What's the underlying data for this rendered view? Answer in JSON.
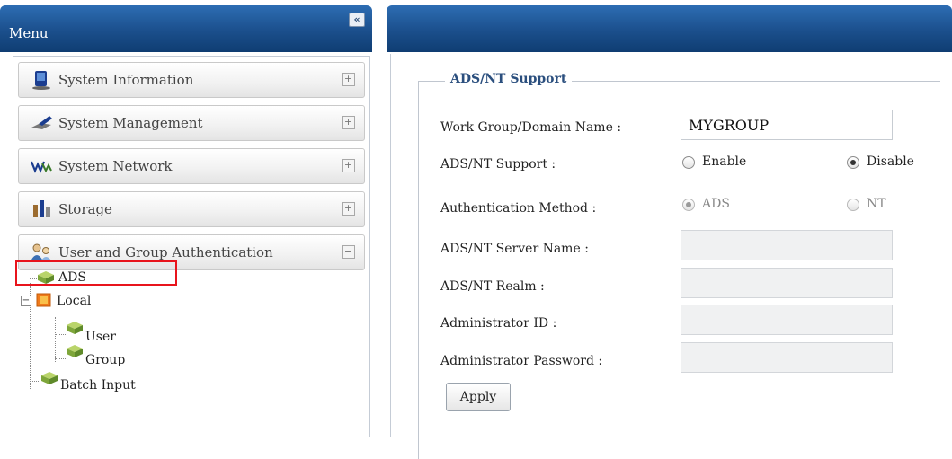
{
  "menu": {
    "title": "Menu",
    "collapse_glyph": "«",
    "items": [
      {
        "label": "System Information",
        "icon": "computer-icon",
        "expander": "+"
      },
      {
        "label": "System Management",
        "icon": "tools-icon",
        "expander": "+"
      },
      {
        "label": "System Network",
        "icon": "network-icon",
        "expander": "+"
      },
      {
        "label": "Storage",
        "icon": "storage-icon",
        "expander": "+"
      },
      {
        "label": "User and Group Authentication",
        "icon": "users-icon",
        "expander": "−"
      }
    ],
    "tree": {
      "ads": "ADS",
      "local": "Local",
      "local_expander": "−",
      "user": "User",
      "group": "Group",
      "batch": "Batch Input"
    }
  },
  "form": {
    "section_title": "ADS/NT Support",
    "workgroup_label": "Work Group/Domain Name :",
    "workgroup_value": "MYGROUP",
    "support_label": "ADS/NT Support :",
    "support_options": {
      "enable": "Enable",
      "disable": "Disable",
      "selected": "Disable"
    },
    "auth_label": "Authentication Method :",
    "auth_options": {
      "ads": "ADS",
      "nt": "NT",
      "selected": "ADS"
    },
    "server_label": "ADS/NT Server Name :",
    "realm_label": "ADS/NT Realm :",
    "admin_id_label": "Administrator ID :",
    "admin_pw_label": "Administrator Password :",
    "apply_label": "Apply"
  },
  "colors": {
    "header_blue": "#1b4f8c",
    "highlight_red": "#e8141c",
    "legend_text": "#2b4f7e"
  }
}
